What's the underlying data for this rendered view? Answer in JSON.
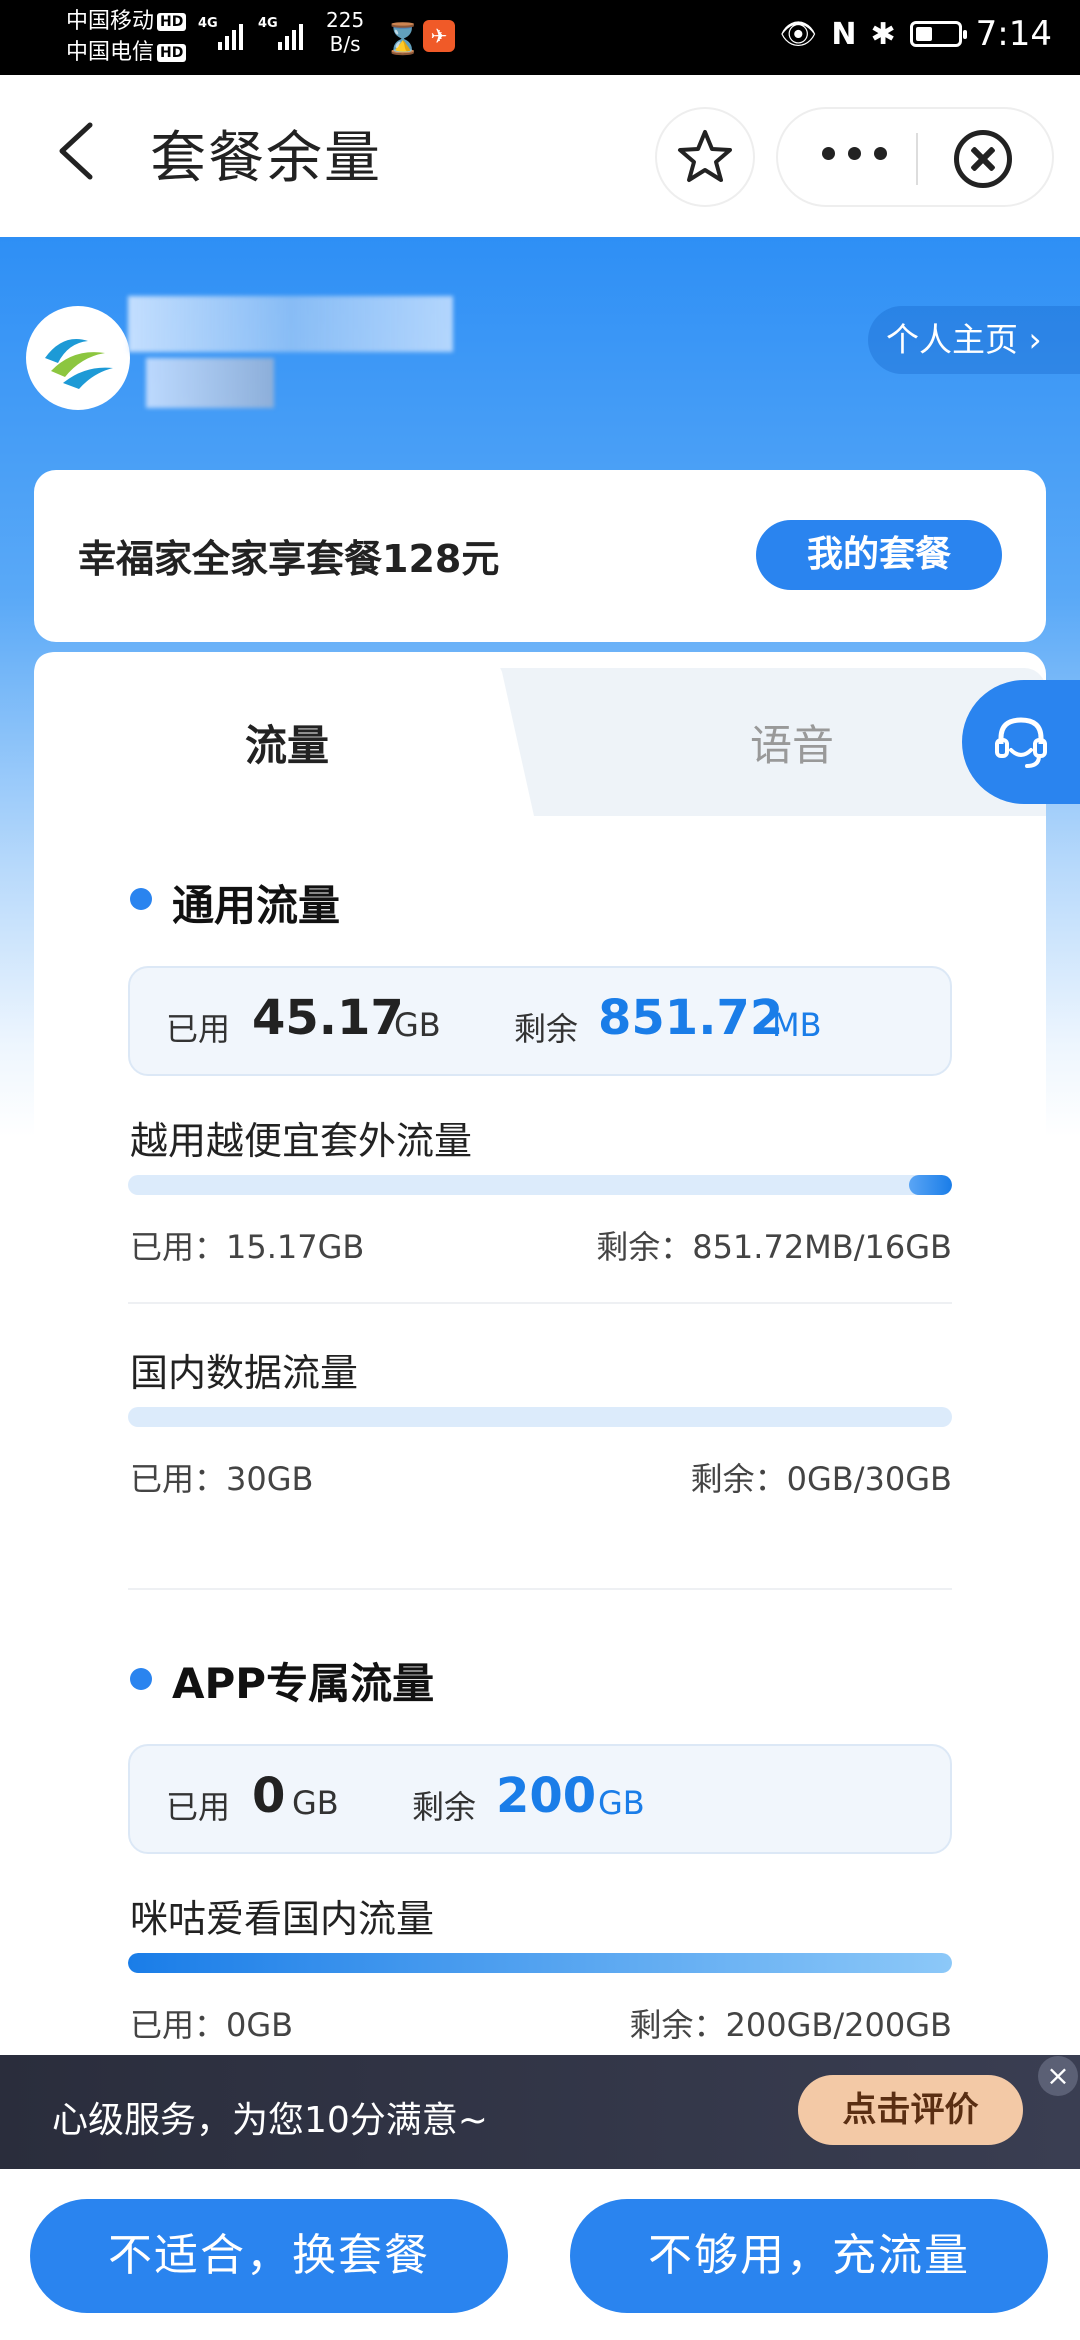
{
  "status_bar": {
    "carrier1": "中国移动",
    "carrier2": "中国电信",
    "hd": "HD",
    "net1": "4G",
    "net2": "4G",
    "speed_value": "225",
    "speed_unit": "B/s",
    "time": "7:14"
  },
  "nav": {
    "title": "套餐余量"
  },
  "profile": {
    "link_label": "个人主页 ›"
  },
  "plan": {
    "name": "幸福家全家享套餐128元",
    "button_label": "我的套餐"
  },
  "tabs": [
    {
      "label": "流量",
      "active": true
    },
    {
      "label": "语音",
      "active": false
    }
  ],
  "general_flow": {
    "title": "通用流量",
    "used_label": "已用",
    "used_value": "45.17",
    "used_unit": "GB",
    "remain_label": "剩余",
    "remain_value": "851.72",
    "remain_unit": "MB",
    "items": [
      {
        "title": "越用越便宜套外流量",
        "used": "已用：15.17GB",
        "remain": "剩余：851.72MB/16GB",
        "remaining_fraction": 0.052
      },
      {
        "title": "国内数据流量",
        "used": "已用：30GB",
        "remain": "剩余：0GB/30GB",
        "remaining_fraction": 0
      }
    ]
  },
  "app_flow": {
    "title": "APP专属流量",
    "used_label": "已用",
    "used_value": "0",
    "used_unit": "GB",
    "remain_label": "剩余",
    "remain_value": "200",
    "remain_unit": "GB",
    "items": [
      {
        "title": "咪咕爱看国内流量",
        "used": "已用：0GB",
        "remain": "剩余：200GB/200GB",
        "remaining_fraction": 1
      }
    ]
  },
  "feedback": {
    "text": "心级服务，为您10分满意~",
    "button_label": "点击评价",
    "close_symbol": "×"
  },
  "bottom_buttons": {
    "change_plan": "不适合，换套餐",
    "recharge": "不够用，充流量"
  },
  "colors": {
    "primary": "#2a84ef",
    "header_blue": "#2e8ff5",
    "rate_button": "#f3c9a6"
  }
}
